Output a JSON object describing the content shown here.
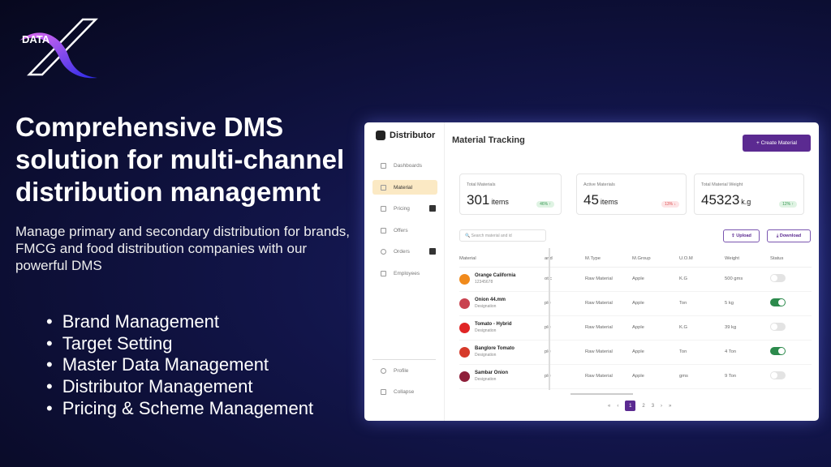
{
  "logo": {
    "text": "DATA X"
  },
  "headline": "Comprehensive DMS solution for multi-channel distribution managemnt",
  "subtitle": "Manage primary and secondary distribution for brands, FMCG and food distribution companies with our powerful DMS",
  "bullets": [
    "Brand Management",
    "Target Setting",
    "Master Data Management",
    "Distributor Management",
    "Pricing & Scheme Management"
  ],
  "app": {
    "brand": "Distributor",
    "nav": [
      {
        "label": "Dashboards"
      },
      {
        "label": "Material",
        "active": true
      },
      {
        "label": "Pricing",
        "badge": true
      },
      {
        "label": "Offers"
      },
      {
        "label": "Orders",
        "badge": true
      },
      {
        "label": "Employees"
      }
    ],
    "bottom_nav": [
      "Profile",
      "Collapse"
    ],
    "title": "Material Tracking",
    "create_label": "+ Create Material",
    "cards": [
      {
        "label": "Total Materials",
        "value": "301",
        "unit": "items",
        "change": "46% ↑"
      },
      {
        "label": "Active Materials",
        "value": "45",
        "unit": "items",
        "change": "13% ↓"
      },
      {
        "label": "Total Material Weight",
        "value": "45323",
        "unit": "k.g",
        "change": "12% ↑"
      }
    ],
    "search_placeholder": "Search material and id",
    "upload_label": "Upload",
    "download_label": "Download",
    "columns": [
      "Material",
      "and",
      "M.Type",
      "M.Group",
      "U.O.M",
      "Weight",
      "Status"
    ],
    "rows": [
      {
        "name": "Orange California",
        "desc": "12345678",
        "brand": "otic",
        "type": "Raw Material",
        "group": "Apple",
        "uom": "K.G",
        "weight": "500 gms",
        "active": false,
        "color": "#f08a1c"
      },
      {
        "name": "Onion 44.mm",
        "desc": "Designation",
        "brand": "ple",
        "type": "Raw Material",
        "group": "Apple",
        "uom": "Ton",
        "weight": "5 kg",
        "active": true,
        "color": "#c9424f"
      },
      {
        "name": "Tomato - Hybrid",
        "desc": "Designation",
        "brand": "ple",
        "type": "Raw Material",
        "group": "Apple",
        "uom": "K.G",
        "weight": "39 kg",
        "active": false,
        "color": "#e02525"
      },
      {
        "name": "Banglore Tomato",
        "desc": "Designation",
        "brand": "ple",
        "type": "Raw Material",
        "group": "Apple",
        "uom": "Ton",
        "weight": "4 Ton",
        "active": true,
        "color": "#d63a2a"
      },
      {
        "name": "Sambar Onion",
        "desc": "Designation",
        "brand": "ple",
        "type": "Raw Material",
        "group": "Apple",
        "uom": "gms",
        "weight": "9 Ton",
        "active": false,
        "color": "#8e1f3a"
      }
    ],
    "pagination": {
      "first": "«",
      "prev": "‹",
      "pages": [
        "1",
        "2",
        "3"
      ],
      "current": "1",
      "next": "›",
      "last": "»"
    }
  }
}
